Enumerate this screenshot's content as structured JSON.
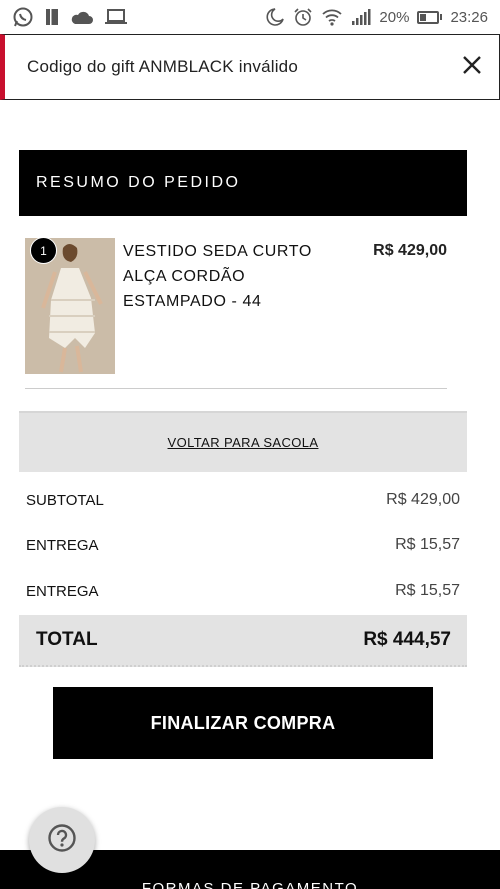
{
  "status_bar": {
    "battery": "20%",
    "time": "23:26",
    "icons_left": [
      "whatsapp-icon",
      "bookmark-icon",
      "cloud-icon",
      "laptop-icon"
    ],
    "icons_right": [
      "moon-icon",
      "alarm-icon",
      "wifi-icon",
      "signal-icon",
      "battery-icon"
    ]
  },
  "alert": {
    "message": "Codigo do gift ANMBLACK inválido",
    "accent_color": "#c8102e"
  },
  "summary": {
    "title": "RESUMO DO PEDIDO"
  },
  "items": [
    {
      "quantity": "1",
      "name": "VESTIDO SEDA CURTO ALÇA CORDÃO ESTAMPADO - 44",
      "price": "R$ 429,00"
    }
  ],
  "back_to_bag": "VOLTAR PARA SACOLA",
  "totals": {
    "subtotal_label": "SUBTOTAL",
    "subtotal_value": "R$ 429,00",
    "shipping_label_1": "ENTREGA",
    "shipping_value_1": "R$ 15,57",
    "shipping_label_2": "ENTREGA",
    "shipping_value_2": "R$ 15,57",
    "total_label": "TOTAL",
    "total_value": "R$ 444,57"
  },
  "finalize_button": "FINALIZAR COMPRA",
  "footer": {
    "title": "FORMAS DE PAGAMENTO"
  },
  "help_button": "help-icon"
}
